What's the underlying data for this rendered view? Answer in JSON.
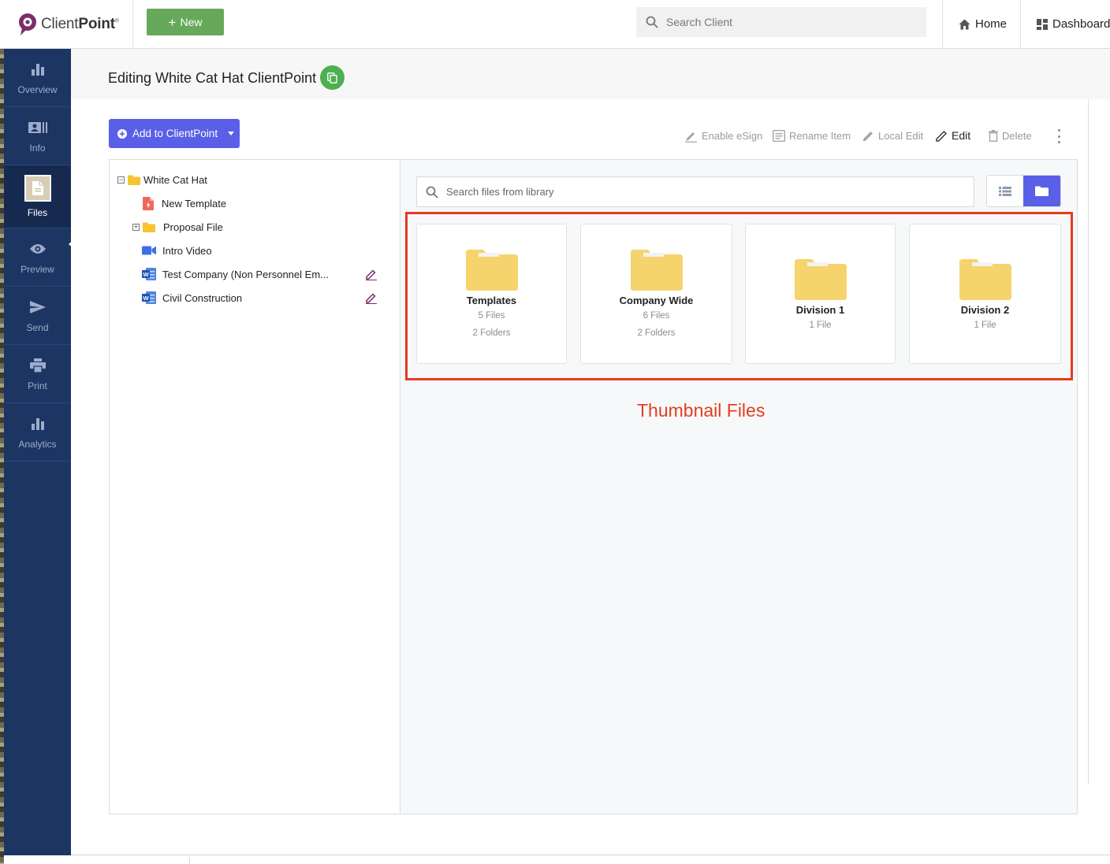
{
  "brand": {
    "name_prefix": "Client",
    "name_bold": "Point",
    "mark": "®"
  },
  "topbar": {
    "new_label": "New",
    "search_placeholder": "Search Client",
    "home_label": "Home",
    "dashboard_label": "Dashboard"
  },
  "sidebar": {
    "items": [
      {
        "label": "Overview",
        "icon": "bar-chart-icon"
      },
      {
        "label": "Info",
        "icon": "id-card-icon"
      },
      {
        "label": "Files",
        "icon": "file-icon",
        "active": true
      },
      {
        "label": "Preview",
        "icon": "eye-icon"
      },
      {
        "label": "Send",
        "icon": "paper-plane-icon"
      },
      {
        "label": "Print",
        "icon": "printer-icon"
      },
      {
        "label": "Analytics",
        "icon": "bar-chart-icon"
      }
    ]
  },
  "page": {
    "title": "Editing White Cat Hat ClientPoint"
  },
  "toolbar": {
    "add_label": "Add to ClientPoint",
    "enable_esign": "Enable eSign",
    "rename_item": "Rename Item",
    "local_edit": "Local Edit",
    "edit": "Edit",
    "delete": "Delete"
  },
  "tree": {
    "root": "White Cat Hat",
    "items": [
      {
        "label": "New Template",
        "icon": "pdf-file-icon"
      },
      {
        "label": "Proposal File",
        "icon": "folder-icon"
      },
      {
        "label": "Intro Video",
        "icon": "video-camera-icon"
      },
      {
        "label": "Test Company (Non Personnel Em...",
        "icon": "word-document-icon"
      },
      {
        "label": "Civil Construction",
        "icon": "word-document-icon"
      }
    ]
  },
  "library": {
    "search_placeholder": "Search files from library"
  },
  "cards": [
    {
      "name": "Templates",
      "files": "5 Files",
      "folders": "2 Folders"
    },
    {
      "name": "Company Wide",
      "files": "6 Files",
      "folders": "2 Folders"
    },
    {
      "name": "Division 1",
      "files": "1 File"
    },
    {
      "name": "Division 2",
      "files": "1 File"
    }
  ],
  "annotation": "Thumbnail Files",
  "colors": {
    "accent": "#5a5fe7",
    "sidebar": "#1d3563",
    "new_button": "#67a95a",
    "folder": "#f5d46e",
    "annotation": "#e23e1f"
  }
}
